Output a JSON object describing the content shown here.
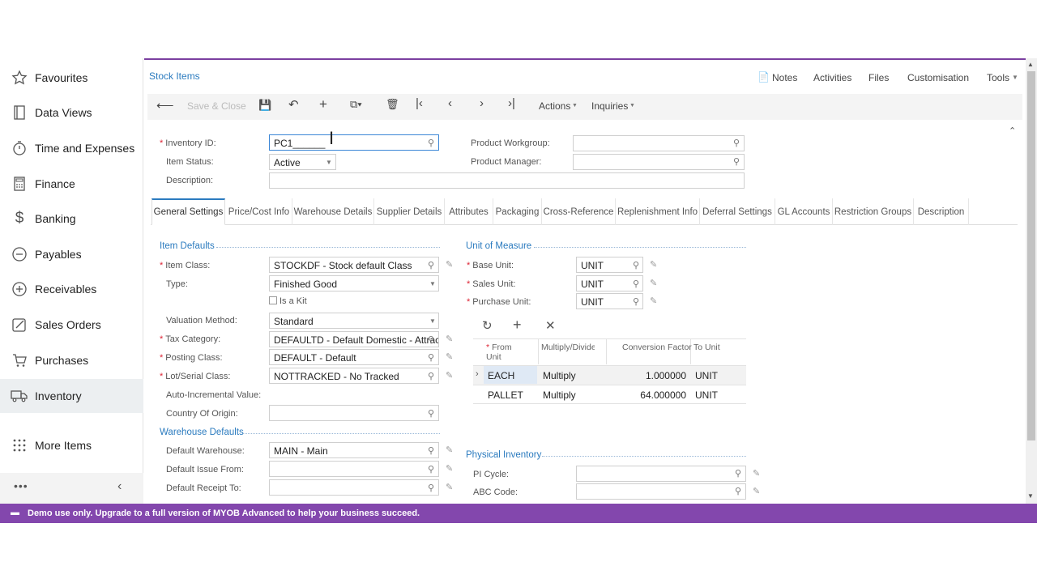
{
  "sidebar": {
    "items": [
      {
        "label": "Favourites",
        "icon": "star-icon"
      },
      {
        "label": "Data Views",
        "icon": "book-icon"
      },
      {
        "label": "Time and Expenses",
        "icon": "stopwatch-icon"
      },
      {
        "label": "Finance",
        "icon": "calculator-icon"
      },
      {
        "label": "Banking",
        "icon": "dollar-icon"
      },
      {
        "label": "Payables",
        "icon": "minus-circle-icon"
      },
      {
        "label": "Receivables",
        "icon": "plus-circle-icon"
      },
      {
        "label": "Sales Orders",
        "icon": "edit-icon"
      },
      {
        "label": "Purchases",
        "icon": "cart-icon"
      },
      {
        "label": "Inventory",
        "icon": "truck-icon"
      },
      {
        "label": "More Items",
        "icon": "grid-dots-icon"
      }
    ],
    "active": "Inventory"
  },
  "header": {
    "breadcrumb": "Stock Items",
    "links": [
      "Notes",
      "Activities",
      "Files",
      "Customisation",
      "Tools"
    ]
  },
  "toolbar": {
    "save_close": "Save & Close",
    "actions": "Actions",
    "inquiries": "Inquiries"
  },
  "top_form": {
    "inventory_id_label": "Inventory ID:",
    "inventory_id_value": "PC1______",
    "item_status_label": "Item Status:",
    "item_status_value": "Active",
    "description_label": "Description:",
    "description_value": "",
    "product_workgroup_label": "Product Workgroup:",
    "product_manager_label": "Product Manager:"
  },
  "tabs": [
    "General Settings",
    "Price/Cost Info",
    "Warehouse Details",
    "Supplier Details",
    "Attributes",
    "Packaging",
    "Cross-Reference",
    "Replenishment Info",
    "Deferral Settings",
    "GL Accounts",
    "Restriction Groups",
    "Description"
  ],
  "active_tab": "General Settings",
  "item_defaults": {
    "title": "Item Defaults",
    "item_class_label": "Item Class:",
    "item_class_value": "STOCKDF - Stock default Class",
    "type_label": "Type:",
    "type_value": "Finished Good",
    "is_kit_label": "Is a Kit",
    "valuation_label": "Valuation Method:",
    "valuation_value": "Standard",
    "tax_label": "Tax Category:",
    "tax_value": "DEFAULTD - Default Domestic - Attrac",
    "posting_label": "Posting Class:",
    "posting_value": "DEFAULT - Default",
    "lot_label": "Lot/Serial Class:",
    "lot_value": "NOTTRACKED - No Tracked",
    "auto_label": "Auto-Incremental Value:",
    "country_label": "Country Of Origin:"
  },
  "warehouse_defaults": {
    "title": "Warehouse Defaults",
    "default_wh_label": "Default Warehouse:",
    "default_wh_value": "MAIN - Main",
    "issue_label": "Default Issue From:",
    "receipt_label": "Default Receipt To:"
  },
  "uom": {
    "title": "Unit of Measure",
    "base_label": "Base Unit:",
    "base_value": "UNIT",
    "sales_label": "Sales Unit:",
    "sales_value": "UNIT",
    "purchase_label": "Purchase Unit:",
    "purchase_value": "UNIT",
    "columns": [
      "From Unit",
      "Multiply/Divide",
      "Conversion Factor",
      "To Unit"
    ],
    "col_from_line1": "From",
    "col_from_line2": "Unit",
    "rows": [
      {
        "from": "EACH",
        "op": "Multiply",
        "factor": "1.000000",
        "to": "UNIT"
      },
      {
        "from": "PALLET",
        "op": "Multiply",
        "factor": "64.000000",
        "to": "UNIT"
      }
    ]
  },
  "physical_inventory": {
    "title": "Physical Inventory",
    "pi_label": "PI Cycle:",
    "abc_label": "ABC Code:"
  },
  "banner": "Demo use only. Upgrade to a full version of MYOB Advanced to help your business succeed.",
  "colors": {
    "accent": "#8347ad",
    "link": "#2b7bbf"
  }
}
